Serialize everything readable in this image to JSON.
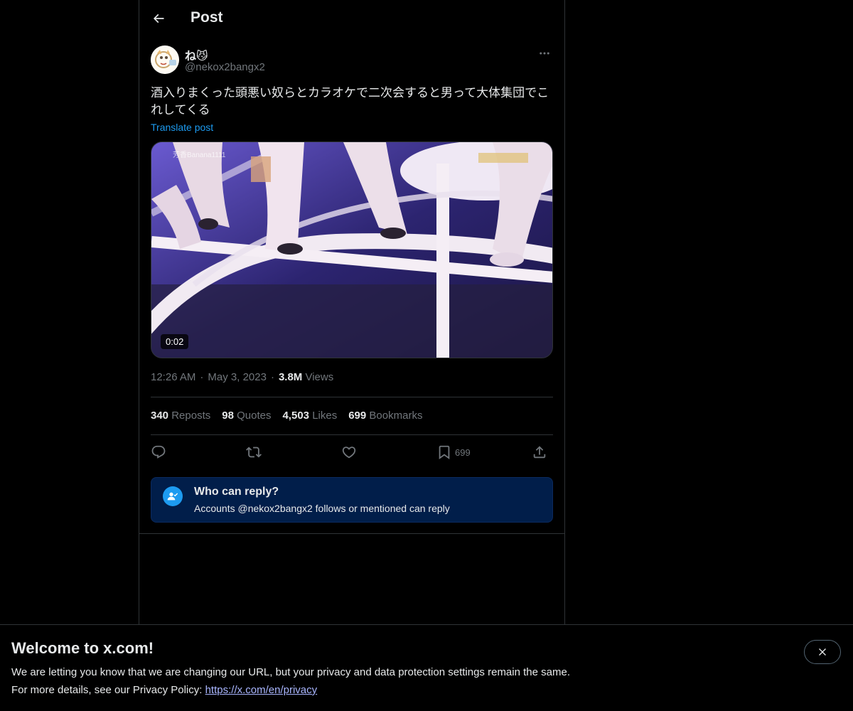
{
  "header": {
    "title": "Post"
  },
  "author": {
    "display_name": "ね😼",
    "handle": "@nekox2bangx2"
  },
  "post": {
    "text": "酒入りまくった頭悪い奴らとカラオケで二次会すると男って大体集団でこれしてくる",
    "translate_label": "Translate post",
    "video_duration": "0:02",
    "video_watermark": "芳香Banana1111",
    "time": "12:26 AM",
    "date": "May 3, 2023",
    "views_count": "3.8M",
    "views_label": "Views",
    "separator": "·"
  },
  "stats": {
    "reposts_count": "340",
    "reposts_label": "Reposts",
    "quotes_count": "98",
    "quotes_label": "Quotes",
    "likes_count": "4,503",
    "likes_label": "Likes",
    "bookmarks_count": "699",
    "bookmarks_label": "Bookmarks"
  },
  "actions": {
    "bookmark_count": "699"
  },
  "reply_restriction": {
    "title": "Who can reply?",
    "description": "Accounts @nekox2bangx2 follows or mentioned can reply"
  },
  "banner": {
    "title": "Welcome to x.com!",
    "line1": "We are letting you know that we are changing our URL, but your privacy and data protection settings remain the same.",
    "line2_prefix": "For more details, see our Privacy Policy: ",
    "link": "https://x.com/en/privacy"
  },
  "icons": [
    "back-arrow-icon",
    "more-icon",
    "reply-icon",
    "repost-icon",
    "like-icon",
    "bookmark-icon",
    "share-icon",
    "person-check-icon",
    "close-icon"
  ],
  "colors": {
    "accent": "#1d9bf0",
    "text": "#e7e9ea",
    "muted": "#71767b",
    "background": "#000000",
    "reply_box": "#011e4a"
  }
}
